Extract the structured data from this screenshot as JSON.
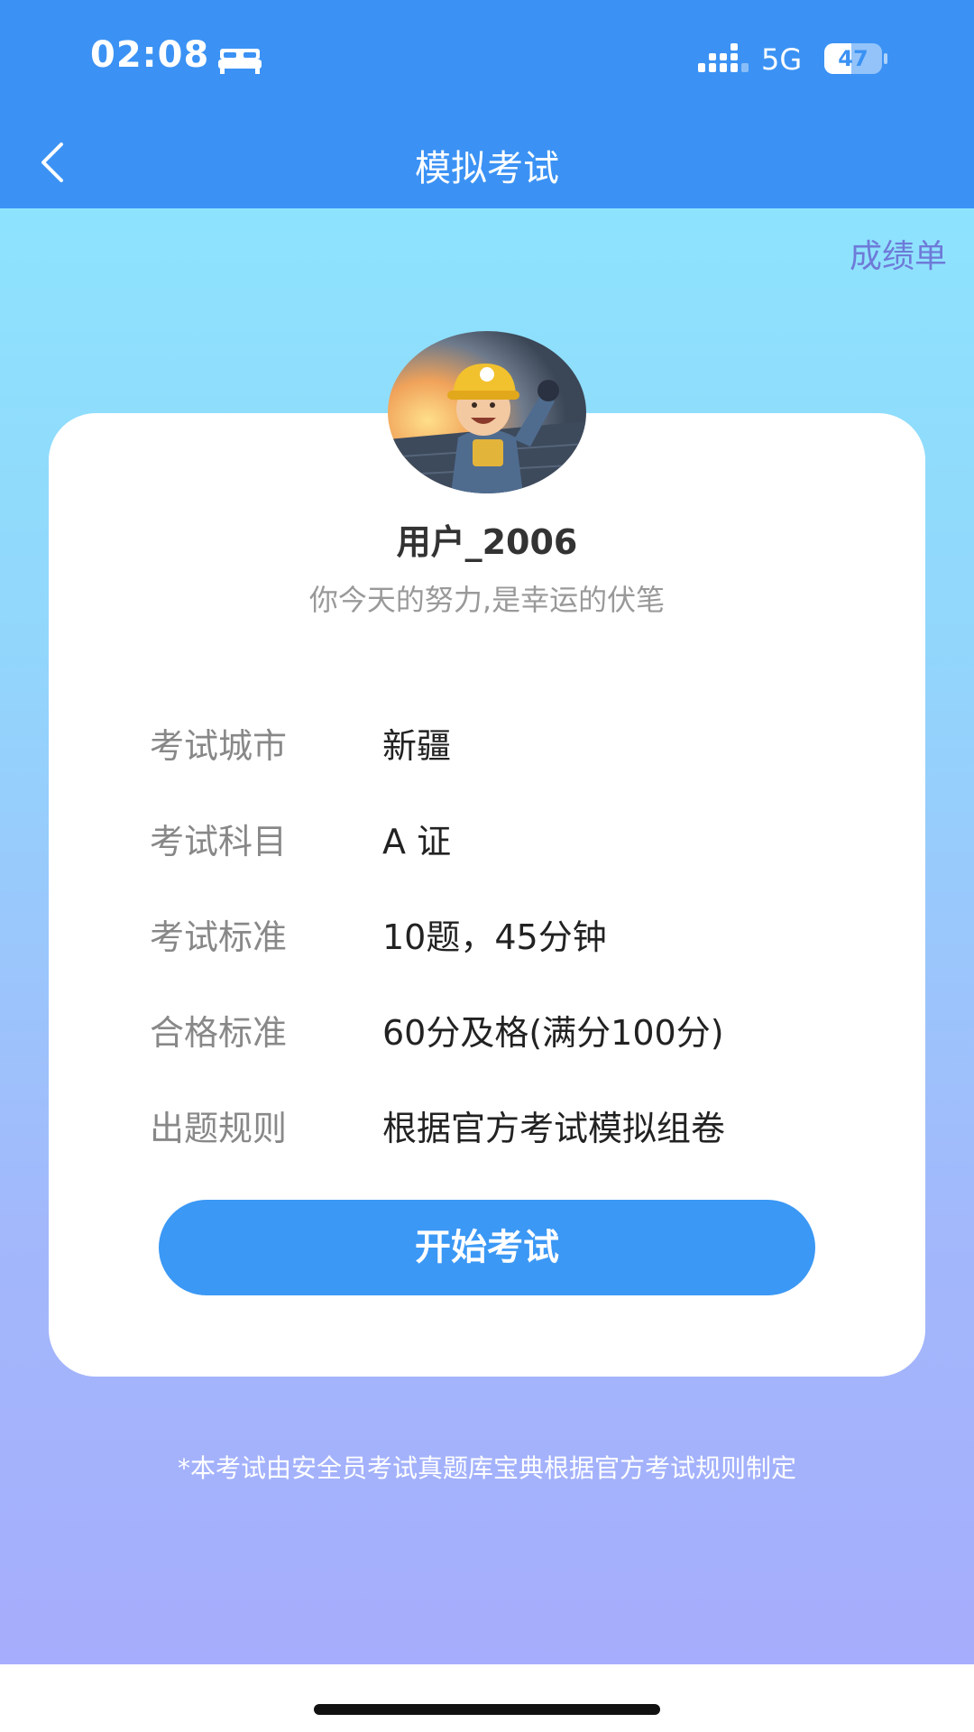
{
  "status_bar": {
    "time": "02:08",
    "network": "5G",
    "battery_level": "47",
    "battery_fraction": 0.47,
    "icons": [
      "bed-icon",
      "signal-icon",
      "battery-icon"
    ]
  },
  "nav": {
    "title": "模拟考试",
    "back_icon": "chevron-left-icon"
  },
  "report_link": "成绩单",
  "profile": {
    "avatar_icon": "avatar",
    "username": "用户_2006",
    "motto": "你今天的努力,是幸运的伏笔"
  },
  "exam_info": [
    {
      "label": "考试城市",
      "value": "新疆"
    },
    {
      "label": "考试科目",
      "value": "A 证"
    },
    {
      "label": "考试标准",
      "value": "10题，45分钟"
    },
    {
      "label": "合格标准",
      "value": "60分及格(满分100分)"
    },
    {
      "label": "出题规则",
      "value": "根据官方考试模拟组卷"
    }
  ],
  "start_button": "开始考试",
  "footnote": "*本考试由安全员考试真题库宝典根据官方考试规则制定",
  "colors": {
    "primary": "#3b92f4",
    "button": "#3b98f5",
    "link": "#6e7ad8",
    "gradient_top": "#8de3fd",
    "gradient_bottom": "#a6adfc"
  }
}
